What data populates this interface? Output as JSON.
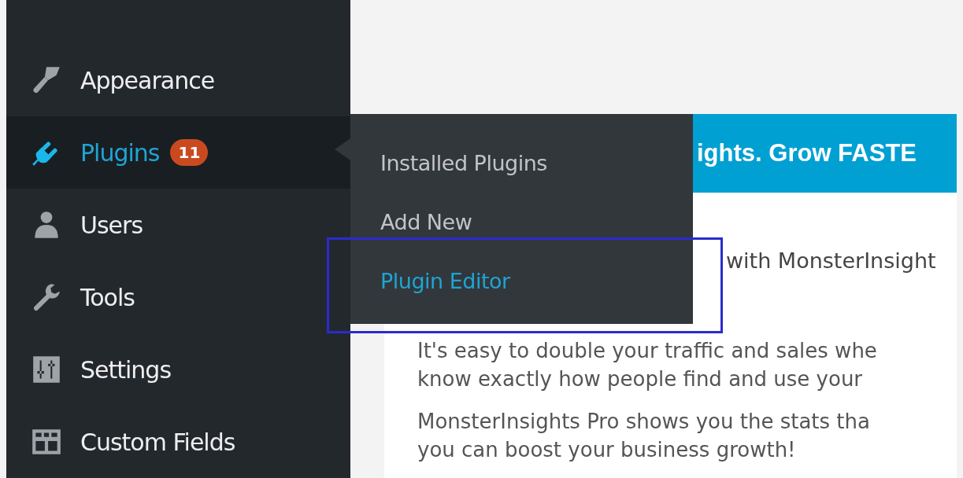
{
  "sidebar": {
    "items": [
      {
        "label": "Appearance",
        "selected": false
      },
      {
        "label": "Plugins",
        "selected": true,
        "badge": "11"
      },
      {
        "label": "Users",
        "selected": false
      },
      {
        "label": "Tools",
        "selected": false
      },
      {
        "label": "Settings",
        "selected": false
      },
      {
        "label": "Custom Fields",
        "selected": false
      }
    ]
  },
  "submenu": {
    "items": [
      {
        "label": "Installed Plugins",
        "selected": false
      },
      {
        "label": "Add New",
        "selected": false
      },
      {
        "label": "Plugin Editor",
        "selected": true
      }
    ]
  },
  "banner": {
    "text": "ights. Grow FASTE"
  },
  "card": {
    "heading": "with MonsterInsight",
    "paragraphs": [
      [
        "It's easy to double your traffic and sales whe",
        "know exactly how people find and use your"
      ],
      [
        "MonsterInsights Pro shows you the stats tha",
        "you can boost your business growth!"
      ]
    ]
  }
}
